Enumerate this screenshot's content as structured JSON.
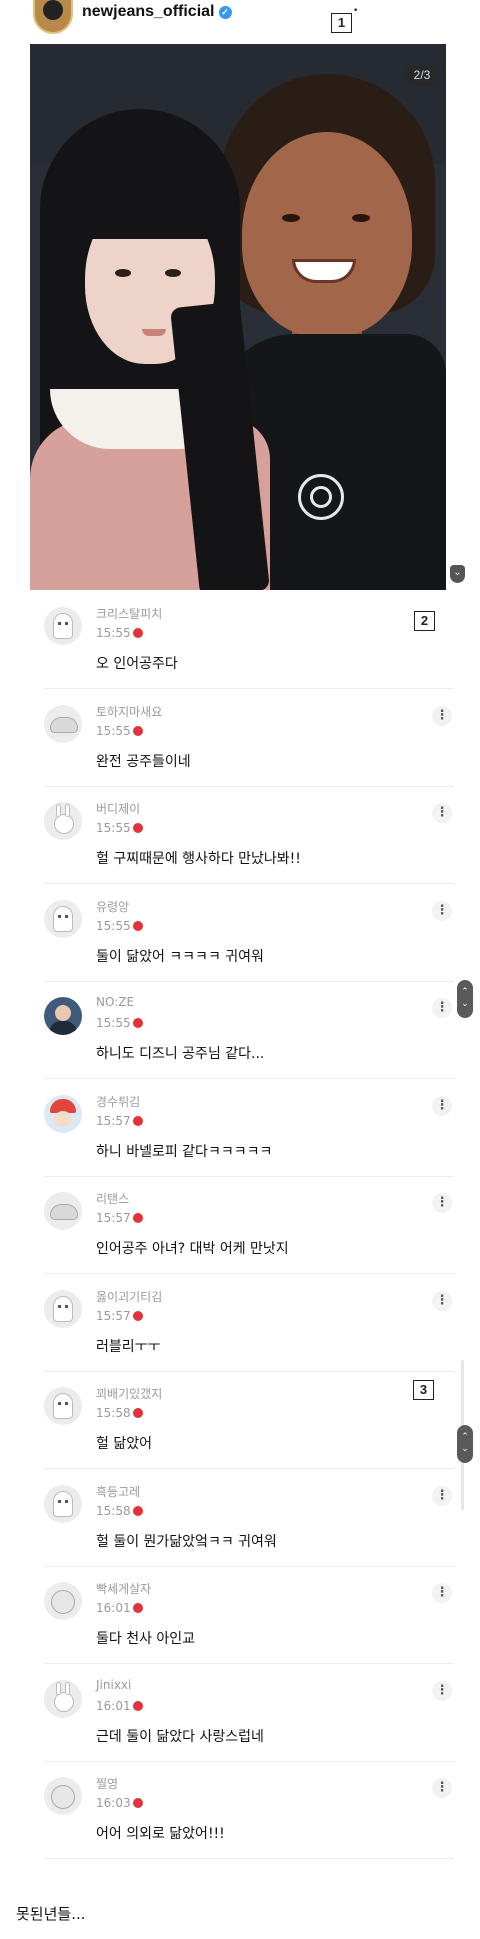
{
  "header": {
    "username": "newjeans_official",
    "verified_icon": "verified-check-icon",
    "marker": "1",
    "marker_dot": "•"
  },
  "photo": {
    "counter": "2/3",
    "scroll_icon": "chevron-down-icon"
  },
  "markers": {
    "two": "2",
    "three": "3"
  },
  "comments": [
    {
      "name": "크리스탈피치",
      "time": "15:55",
      "text": "오 인어공주다",
      "avatar": "ghost"
    },
    {
      "name": "토하지마새요",
      "time": "15:55",
      "text": "완전 공주들이네",
      "avatar": "dino"
    },
    {
      "name": "버디제이",
      "time": "15:55",
      "text": "헐 구찌때문에 행사하다 만났나봐!!",
      "avatar": "rabbit"
    },
    {
      "name": "유령앙",
      "time": "15:55",
      "text": "둘이 닮았어 ㅋㅋㅋㅋ 귀여워",
      "avatar": "ghost"
    },
    {
      "name": "NO:ZE",
      "time": "15:55",
      "text": "하니도 디즈니 공주님 같다...",
      "avatar": "photo1"
    },
    {
      "name": "경수튀김",
      "time": "15:57",
      "text": "하니 바넬로피 같다ㅋㅋㅋㅋㅋ",
      "avatar": "photo2"
    },
    {
      "name": "리탠스",
      "time": "15:57",
      "text": "인어공주 아녀? 대박 어케 만낫지",
      "avatar": "dino"
    },
    {
      "name": "옳이괴기티김",
      "time": "15:57",
      "text": "러블리ㅜㅜ",
      "avatar": "ghost"
    },
    {
      "name": "꾀배기있갰지",
      "time": "15:58",
      "text": "헐 닮았어",
      "avatar": "ghost"
    },
    {
      "name": "흑등고레",
      "time": "15:58",
      "text": "헐 둘이 뭔가닮았엌ㅋㅋ 귀여워",
      "avatar": "ghost"
    },
    {
      "name": "빡세게살자",
      "time": "16:01",
      "text": "둘다 천사 아인교",
      "avatar": "pig"
    },
    {
      "name": "Jinixxi",
      "time": "16:01",
      "text": "근데 둘이 닮았다 사랑스럽네",
      "avatar": "rabbit"
    },
    {
      "name": "찔영",
      "time": "16:03",
      "text": "어어 의외로 닮았어!!!",
      "avatar": "pig"
    }
  ],
  "footer_text": "못된년들..."
}
